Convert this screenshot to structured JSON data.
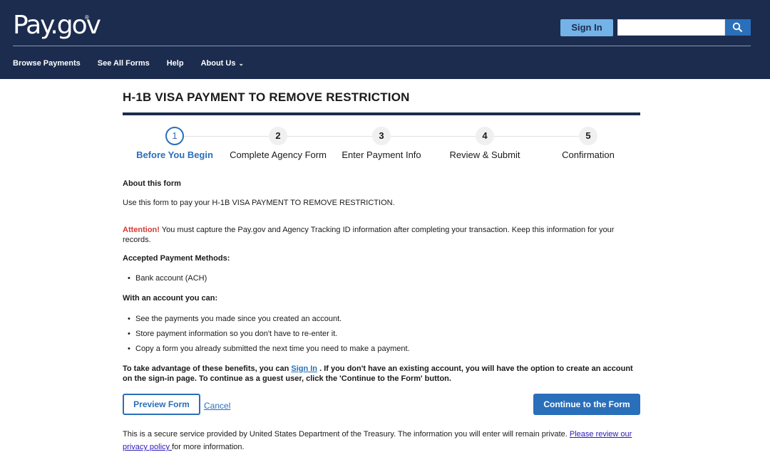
{
  "header": {
    "logo_text": "Pay.gov",
    "logo_reg": "®",
    "signin_label": "Sign In",
    "search_value": "",
    "search_icon": "search-icon",
    "bg_color": "#1c2c4f"
  },
  "nav": {
    "items": [
      {
        "label": "Browse Payments"
      },
      {
        "label": "See All Forms"
      },
      {
        "label": "Help"
      },
      {
        "label": "About Us",
        "has_dropdown": true
      }
    ],
    "about_chevron": "⌄"
  },
  "page": {
    "title": "H-1B VISA PAYMENT TO REMOVE RESTRICTION"
  },
  "stepper": {
    "active_step": 1,
    "steps": [
      {
        "number": "1",
        "label": "Before You Begin"
      },
      {
        "number": "2",
        "label": "Complete Agency Form"
      },
      {
        "number": "3",
        "label": "Enter Payment Info"
      },
      {
        "number": "4",
        "label": "Review & Submit"
      },
      {
        "number": "5",
        "label": "Confirmation"
      }
    ]
  },
  "content": {
    "about_heading": "About this form",
    "use_text": "Use this form to pay your H-1B VISA PAYMENT TO REMOVE RESTRICTION.",
    "attention_word": "Attention!",
    "attention_text": " You must capture the Pay.gov and Agency Tracking ID information after completing your transaction. Keep this information for your records.",
    "methods_heading": "Accepted Payment Methods:",
    "methods": [
      "Bank account (ACH)"
    ],
    "account_heading": "With an account you can:",
    "account_benefits": [
      "See the payments you made since you created an account.",
      "Store payment information so you don't have to re-enter it.",
      "Copy a form you already submitted the next time you need to make a payment."
    ],
    "benefits_prefix": "To take advantage of these benefits, you can ",
    "benefits_link": "Sign In",
    "benefits_suffix": " . If you don't have an existing account, you will have the option to create an account on the sign-in page. To continue as a guest user, click the 'Continue to the Form' button.",
    "preview_label": "Preview Form",
    "cancel_label": "Cancel",
    "continue_label": "Continue to the Form",
    "secure_prefix": "This is a secure service provided by United States Department of the Treasury. The information you will enter will remain private. ",
    "secure_link": "Please review our privacy policy ",
    "secure_suffix": "for more information."
  },
  "colors": {
    "accent_blue": "#2a6fba",
    "signin_bg": "#73b3e7",
    "attention_red": "#d83933"
  }
}
